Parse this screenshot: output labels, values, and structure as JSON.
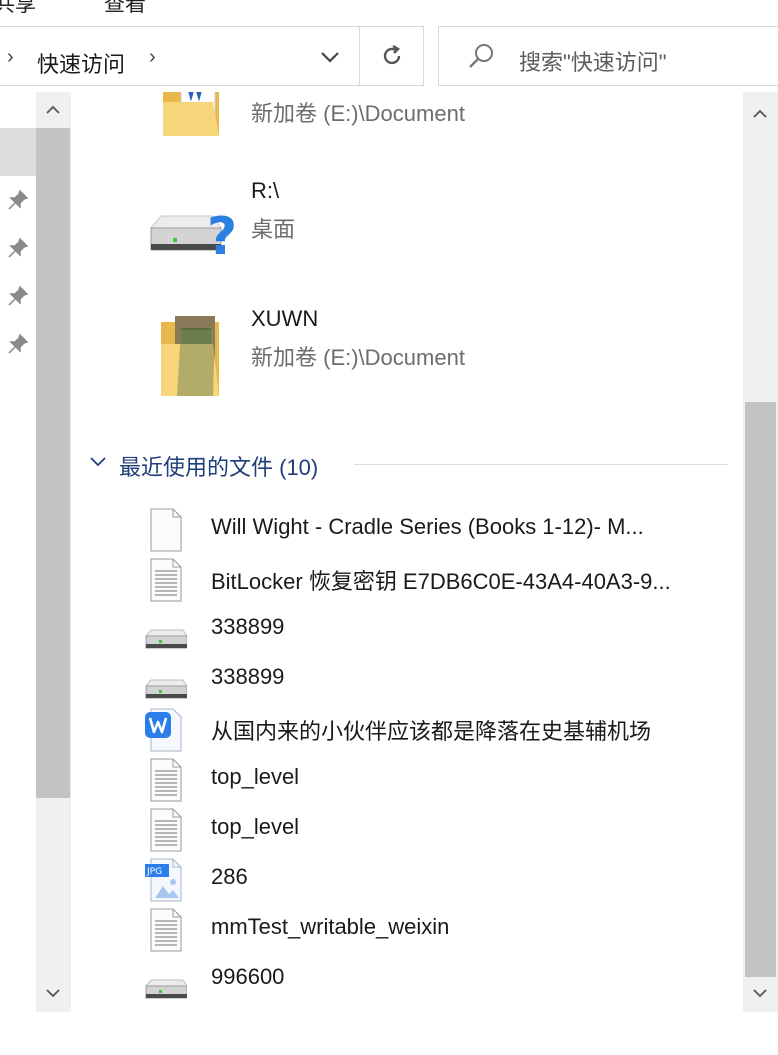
{
  "ribbon": {
    "tab_share": "共享",
    "tab_view": "查看"
  },
  "address": {
    "breadcrumb_label": "快速访问",
    "separator_glyph": "›"
  },
  "search": {
    "placeholder": "搜索\"快速访问\""
  },
  "quick_access_items": [
    {
      "title": "",
      "subtitle": "新加卷 (E:)\\Document",
      "icon": "folder-with-word-doc-icon"
    },
    {
      "title": "R:\\",
      "subtitle": "桌面",
      "icon": "unknown-drive-icon"
    },
    {
      "title": "XUWN",
      "subtitle": "新加卷 (E:)\\Document",
      "icon": "folder-with-photo-icon"
    }
  ],
  "recent_group": {
    "label": "最近使用的文件 (10)"
  },
  "recent_files": [
    {
      "name": "Will Wight - Cradle Series (Books 1-12)- M...",
      "icon": "blank-file-icon"
    },
    {
      "name": "BitLocker 恢复密钥 E7DB6C0E-43A4-40A3-9...",
      "icon": "text-file-icon"
    },
    {
      "name": "338899",
      "icon": "drive-icon"
    },
    {
      "name": "338899",
      "icon": "drive-icon"
    },
    {
      "name": "从国内来的小伙伴应该都是降落在史基辅机场",
      "icon": "wps-doc-icon"
    },
    {
      "name": "top_level",
      "icon": "text-file-icon"
    },
    {
      "name": "top_level",
      "icon": "text-file-icon"
    },
    {
      "name": "286",
      "icon": "jpg-file-icon"
    },
    {
      "name": "mmTest_writable_weixin",
      "icon": "text-file-icon"
    },
    {
      "name": "996600",
      "icon": "drive-icon"
    }
  ],
  "jpg_badge": "JPG",
  "colors": {
    "accent_header": "#1f3e7a",
    "scroll_track": "#f0f0f0",
    "scroll_thumb": "#c3c3c3",
    "folder_yellow": "#f7d57a",
    "wps_blue": "#2b7de9"
  }
}
